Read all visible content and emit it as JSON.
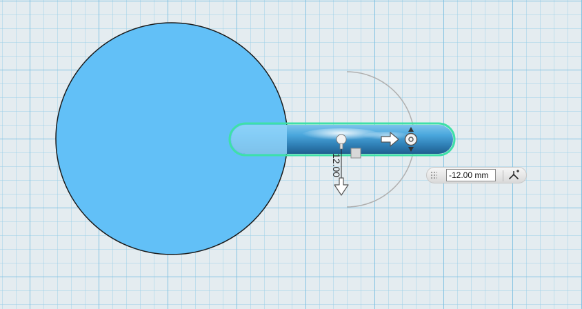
{
  "dimension": {
    "label": "12.00",
    "input_value": "-12.00 mm",
    "unit": "mm"
  },
  "icons": {
    "move_arrow": "arrow-right-icon",
    "lift_arrow": "arrow-down-icon",
    "rotate_handle": "rotate-handle-icon",
    "snap": "snap-toggle-icon"
  },
  "colors": {
    "grid_background": "#e4ecf0",
    "grid_line": "#78bee1",
    "circle_fill": "#62c0f7",
    "bar_fill": "#3d9fd8",
    "selection_outline": "#3fe0a8"
  }
}
